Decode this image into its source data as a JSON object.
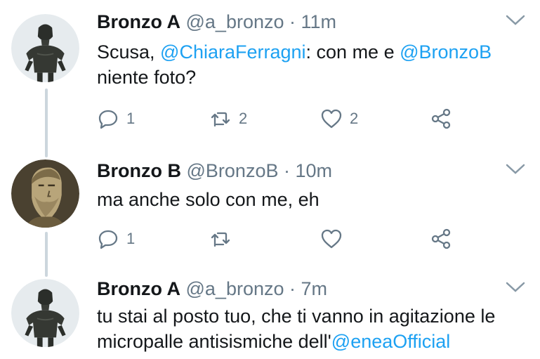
{
  "tweets": [
    {
      "name": "Bronzo A",
      "handle": "@a_bronzo",
      "dot": "·",
      "time": "11m",
      "avatar_icon": "bronze-statue-a-avatar",
      "text": {
        "p1": "Scusa, ",
        "m1": "@ChiaraFerragni",
        "p2": ": con me e ",
        "m2": "@BronzoB",
        "p3": " niente foto?"
      },
      "replies": "1",
      "retweets": "2",
      "likes": "2"
    },
    {
      "name": "Bronzo B",
      "handle": "@BronzoB",
      "dot": "·",
      "time": "10m",
      "avatar_icon": "bronze-statue-b-avatar",
      "text": {
        "p1": "ma anche solo con me, eh"
      },
      "replies": "1",
      "retweets": "",
      "likes": ""
    },
    {
      "name": "Bronzo A",
      "handle": "@a_bronzo",
      "dot": "·",
      "time": "7m",
      "avatar_icon": "bronze-statue-a-avatar",
      "text": {
        "p1": "tu stai al posto tuo, che ti vanno in agitazione le micropalle antisismiche dell'",
        "m1": "@eneaOfficial"
      }
    }
  ],
  "colors": {
    "mention": "#1da1f2",
    "secondary": "#657786",
    "thread_line": "#ccd6dd"
  }
}
